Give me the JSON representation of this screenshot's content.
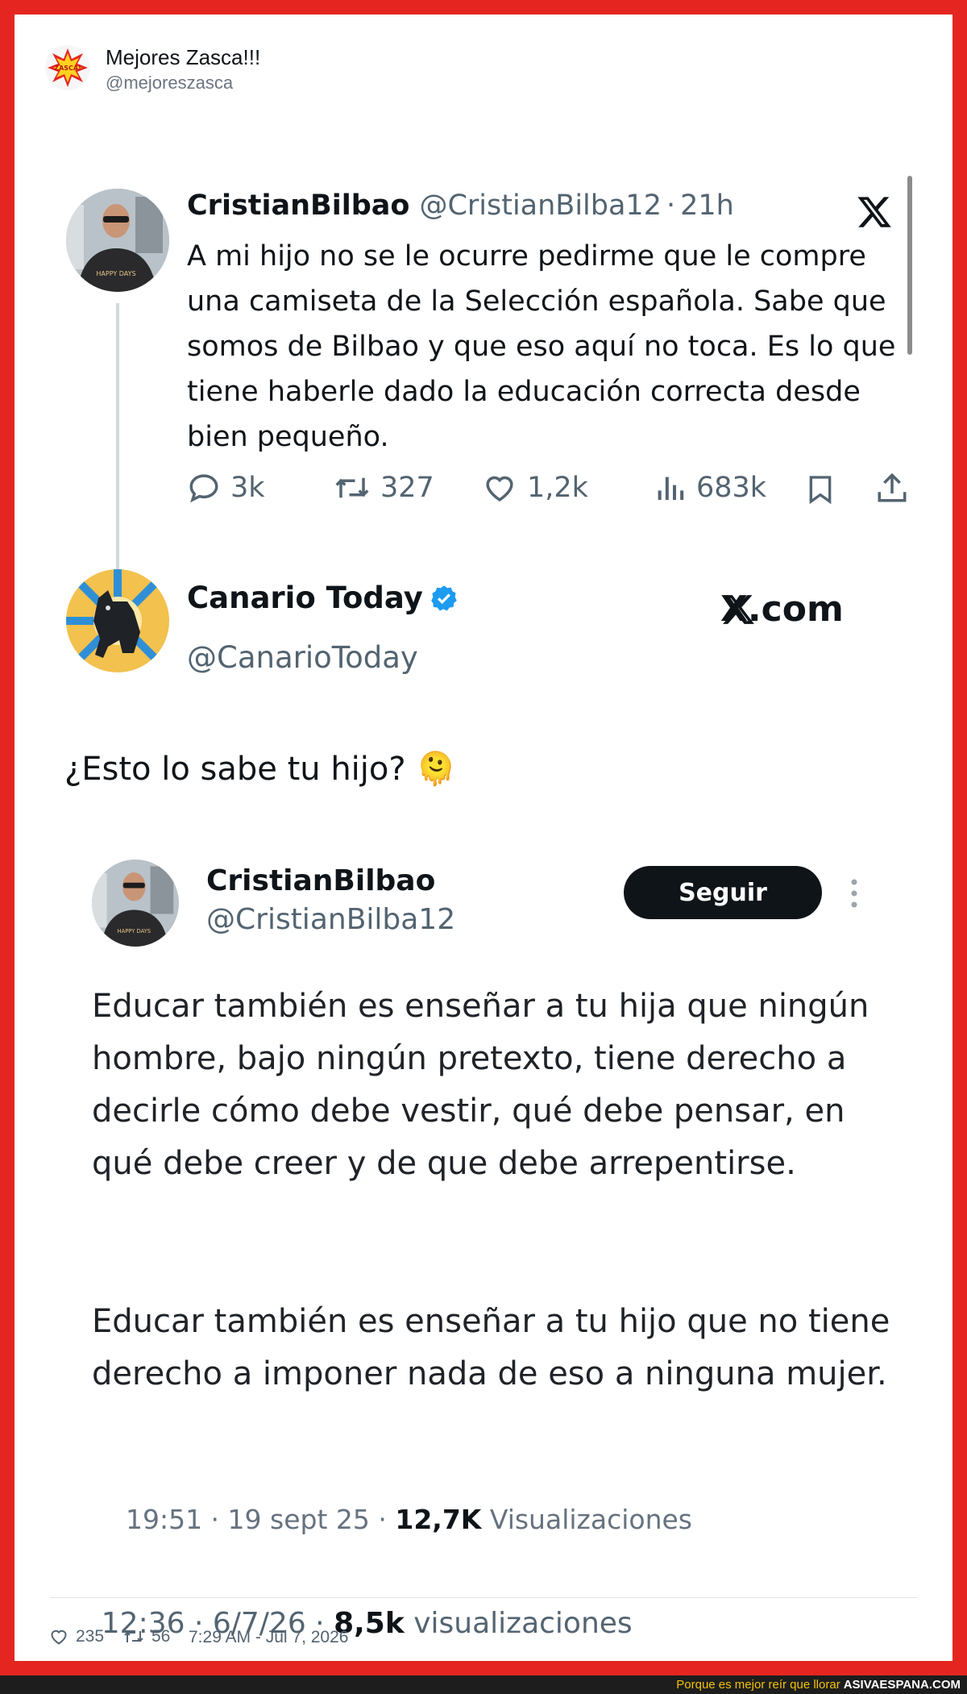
{
  "wrapper": {
    "name": "Mejores Zasca!!!",
    "handle": "@mejoreszasca",
    "avatar_text": "ZASCA!",
    "likes": "235",
    "retweets": "56",
    "timestamp": "7:29 AM - Jul 7, 2026"
  },
  "tweet1": {
    "name": "CristianBilbao",
    "handle": "@CristianBilba12",
    "sep": "·",
    "time": "21h",
    "body": "A mi hijo no se le ocurre pedirme que le compre una camiseta de la Selección española. Sabe que somos de Bilbao y que eso aquí no toca. Es lo que tiene haberle dado la educación correcta desde bien pequeño.",
    "replies": "3k",
    "retweets": "327",
    "likes": "1,2k",
    "views": "683k",
    "shirt_text": "HAPPY DAYS"
  },
  "tweet2": {
    "name": "Canario Today",
    "handle": "@CanarioToday",
    "brand": "X.com",
    "body": "¿Esto lo sabe tu hijo? 🫠",
    "time": "12:36 · 6/7/26 · ",
    "views_count": "8,5k",
    "views_label": " visualizaciones"
  },
  "quote": {
    "name": "CristianBilbao",
    "handle": "@CristianBilba12",
    "follow_label": "Seguir",
    "para1": "Educar también es enseñar a tu hija que ningún hombre, bajo ningún pretexto, tiene derecho a decirle cómo debe vestir, qué debe pensar, en qué debe creer y de que debe arrepentirse.",
    "para2": "Educar también es enseñar a tu hijo que no tiene derecho a imponer nada de eso a ninguna mujer.",
    "meta_time": "19:51 · 19 sept 25 · ",
    "views_count": "12,7K",
    "views_label": " Visualizaciones"
  },
  "footer": {
    "tagline": "Porque es mejor reír que llorar",
    "site": "ASIVAESPANA.COM"
  },
  "colors": {
    "frame": "#e52620",
    "verified": "#1d9bf0",
    "muted": "#536471",
    "follow_bg": "#0f1419"
  },
  "icons": [
    "reply-icon",
    "retweet-icon",
    "like-icon",
    "views-icon",
    "bookmark-icon",
    "share-icon",
    "x-logo-icon",
    "verified-badge-icon",
    "more-options-icon"
  ]
}
